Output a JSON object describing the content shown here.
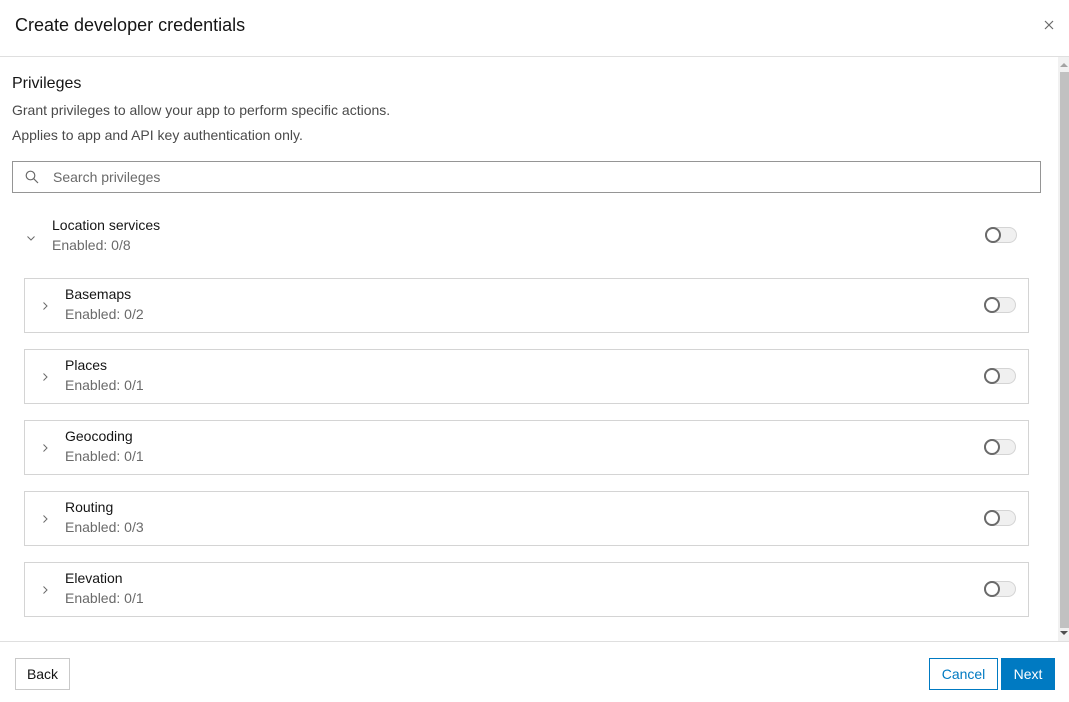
{
  "dialog": {
    "title": "Create developer credentials",
    "close_icon": "close-icon"
  },
  "privileges": {
    "title": "Privileges",
    "description_1": "Grant privileges to allow your app to perform specific actions.",
    "description_2": "Applies to app and API key authentication only.",
    "search": {
      "placeholder": "Search privileges",
      "value": "",
      "icon": "search-icon"
    },
    "group": {
      "name": "Location services",
      "status": "Enabled: 0/8",
      "expanded": true,
      "enabled": false
    },
    "items": [
      {
        "name": "Basemaps",
        "status": "Enabled: 0/2",
        "expanded": false,
        "enabled": false
      },
      {
        "name": "Places",
        "status": "Enabled: 0/1",
        "expanded": false,
        "enabled": false
      },
      {
        "name": "Geocoding",
        "status": "Enabled: 0/1",
        "expanded": false,
        "enabled": false
      },
      {
        "name": "Routing",
        "status": "Enabled: 0/3",
        "expanded": false,
        "enabled": false
      },
      {
        "name": "Elevation",
        "status": "Enabled: 0/1",
        "expanded": false,
        "enabled": false
      }
    ]
  },
  "footer": {
    "back_label": "Back",
    "cancel_label": "Cancel",
    "next_label": "Next"
  },
  "colors": {
    "accent": "#007ac2",
    "border": "#d4d4d4",
    "text_secondary": "#6a6a6a"
  }
}
